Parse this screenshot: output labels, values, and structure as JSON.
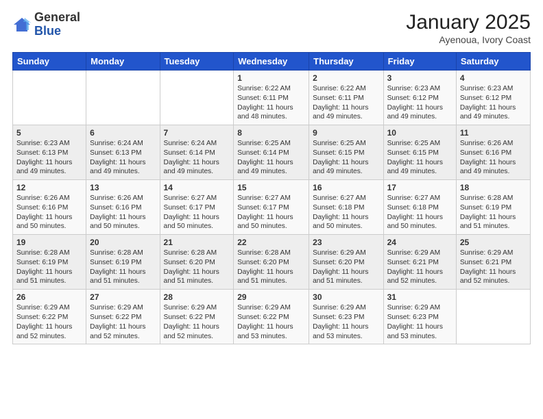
{
  "header": {
    "logo_general": "General",
    "logo_blue": "Blue",
    "month_title": "January 2025",
    "location": "Ayenoua, Ivory Coast"
  },
  "days_of_week": [
    "Sunday",
    "Monday",
    "Tuesday",
    "Wednesday",
    "Thursday",
    "Friday",
    "Saturday"
  ],
  "weeks": [
    [
      {
        "day": "",
        "info": ""
      },
      {
        "day": "",
        "info": ""
      },
      {
        "day": "",
        "info": ""
      },
      {
        "day": "1",
        "info": "Sunrise: 6:22 AM\nSunset: 6:11 PM\nDaylight: 11 hours and 48 minutes."
      },
      {
        "day": "2",
        "info": "Sunrise: 6:22 AM\nSunset: 6:11 PM\nDaylight: 11 hours and 49 minutes."
      },
      {
        "day": "3",
        "info": "Sunrise: 6:23 AM\nSunset: 6:12 PM\nDaylight: 11 hours and 49 minutes."
      },
      {
        "day": "4",
        "info": "Sunrise: 6:23 AM\nSunset: 6:12 PM\nDaylight: 11 hours and 49 minutes."
      }
    ],
    [
      {
        "day": "5",
        "info": "Sunrise: 6:23 AM\nSunset: 6:13 PM\nDaylight: 11 hours and 49 minutes."
      },
      {
        "day": "6",
        "info": "Sunrise: 6:24 AM\nSunset: 6:13 PM\nDaylight: 11 hours and 49 minutes."
      },
      {
        "day": "7",
        "info": "Sunrise: 6:24 AM\nSunset: 6:14 PM\nDaylight: 11 hours and 49 minutes."
      },
      {
        "day": "8",
        "info": "Sunrise: 6:25 AM\nSunset: 6:14 PM\nDaylight: 11 hours and 49 minutes."
      },
      {
        "day": "9",
        "info": "Sunrise: 6:25 AM\nSunset: 6:15 PM\nDaylight: 11 hours and 49 minutes."
      },
      {
        "day": "10",
        "info": "Sunrise: 6:25 AM\nSunset: 6:15 PM\nDaylight: 11 hours and 49 minutes."
      },
      {
        "day": "11",
        "info": "Sunrise: 6:26 AM\nSunset: 6:16 PM\nDaylight: 11 hours and 49 minutes."
      }
    ],
    [
      {
        "day": "12",
        "info": "Sunrise: 6:26 AM\nSunset: 6:16 PM\nDaylight: 11 hours and 50 minutes."
      },
      {
        "day": "13",
        "info": "Sunrise: 6:26 AM\nSunset: 6:16 PM\nDaylight: 11 hours and 50 minutes."
      },
      {
        "day": "14",
        "info": "Sunrise: 6:27 AM\nSunset: 6:17 PM\nDaylight: 11 hours and 50 minutes."
      },
      {
        "day": "15",
        "info": "Sunrise: 6:27 AM\nSunset: 6:17 PM\nDaylight: 11 hours and 50 minutes."
      },
      {
        "day": "16",
        "info": "Sunrise: 6:27 AM\nSunset: 6:18 PM\nDaylight: 11 hours and 50 minutes."
      },
      {
        "day": "17",
        "info": "Sunrise: 6:27 AM\nSunset: 6:18 PM\nDaylight: 11 hours and 50 minutes."
      },
      {
        "day": "18",
        "info": "Sunrise: 6:28 AM\nSunset: 6:19 PM\nDaylight: 11 hours and 51 minutes."
      }
    ],
    [
      {
        "day": "19",
        "info": "Sunrise: 6:28 AM\nSunset: 6:19 PM\nDaylight: 11 hours and 51 minutes."
      },
      {
        "day": "20",
        "info": "Sunrise: 6:28 AM\nSunset: 6:19 PM\nDaylight: 11 hours and 51 minutes."
      },
      {
        "day": "21",
        "info": "Sunrise: 6:28 AM\nSunset: 6:20 PM\nDaylight: 11 hours and 51 minutes."
      },
      {
        "day": "22",
        "info": "Sunrise: 6:28 AM\nSunset: 6:20 PM\nDaylight: 11 hours and 51 minutes."
      },
      {
        "day": "23",
        "info": "Sunrise: 6:29 AM\nSunset: 6:20 PM\nDaylight: 11 hours and 51 minutes."
      },
      {
        "day": "24",
        "info": "Sunrise: 6:29 AM\nSunset: 6:21 PM\nDaylight: 11 hours and 52 minutes."
      },
      {
        "day": "25",
        "info": "Sunrise: 6:29 AM\nSunset: 6:21 PM\nDaylight: 11 hours and 52 minutes."
      }
    ],
    [
      {
        "day": "26",
        "info": "Sunrise: 6:29 AM\nSunset: 6:22 PM\nDaylight: 11 hours and 52 minutes."
      },
      {
        "day": "27",
        "info": "Sunrise: 6:29 AM\nSunset: 6:22 PM\nDaylight: 11 hours and 52 minutes."
      },
      {
        "day": "28",
        "info": "Sunrise: 6:29 AM\nSunset: 6:22 PM\nDaylight: 11 hours and 52 minutes."
      },
      {
        "day": "29",
        "info": "Sunrise: 6:29 AM\nSunset: 6:22 PM\nDaylight: 11 hours and 53 minutes."
      },
      {
        "day": "30",
        "info": "Sunrise: 6:29 AM\nSunset: 6:23 PM\nDaylight: 11 hours and 53 minutes."
      },
      {
        "day": "31",
        "info": "Sunrise: 6:29 AM\nSunset: 6:23 PM\nDaylight: 11 hours and 53 minutes."
      },
      {
        "day": "",
        "info": ""
      }
    ]
  ]
}
